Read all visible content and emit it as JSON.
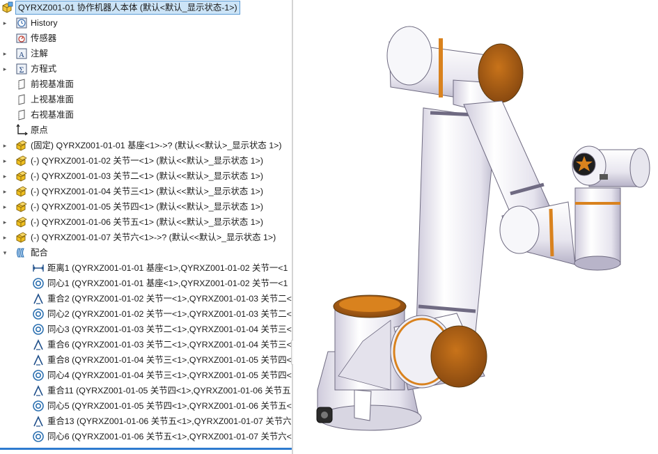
{
  "tree": {
    "root": {
      "label": "QYRXZ001-01 协作机器人本体  (默认<默认_显示状态-1>)",
      "icon": "assembly-icon"
    },
    "items": [
      {
        "label": "History",
        "icon": "history-icon",
        "expander": true
      },
      {
        "label": "传感器",
        "icon": "sensor-icon",
        "expander": false
      },
      {
        "label": "注解",
        "icon": "annotation-icon",
        "expander": true
      },
      {
        "label": "方程式",
        "icon": "equation-icon",
        "expander": true
      },
      {
        "label": "前视基准面",
        "icon": "plane-icon",
        "expander": false
      },
      {
        "label": "上视基准面",
        "icon": "plane-icon",
        "expander": false
      },
      {
        "label": "右视基准面",
        "icon": "plane-icon",
        "expander": false
      },
      {
        "label": "原点",
        "icon": "origin-icon",
        "expander": false
      },
      {
        "label": "(固定) QYRXZ001-01-01 基座<1>->? (默认<<默认>_显示状态 1>)",
        "icon": "part-icon",
        "expander": true
      },
      {
        "label": "(-) QYRXZ001-01-02 关节一<1> (默认<<默认>_显示状态 1>)",
        "icon": "part-icon",
        "expander": true
      },
      {
        "label": "(-) QYRXZ001-01-03 关节二<1> (默认<<默认>_显示状态 1>)",
        "icon": "part-icon",
        "expander": true
      },
      {
        "label": "(-) QYRXZ001-01-04 关节三<1> (默认<<默认>_显示状态 1>)",
        "icon": "part-icon",
        "expander": true
      },
      {
        "label": "(-) QYRXZ001-01-05 关节四<1> (默认<<默认>_显示状态 1>)",
        "icon": "part-icon",
        "expander": true
      },
      {
        "label": "(-) QYRXZ001-01-06 关节五<1> (默认<<默认>_显示状态 1>)",
        "icon": "part-icon",
        "expander": true
      },
      {
        "label": "(-) QYRXZ001-01-07 关节六<1>->? (默认<<默认>_显示状态 1>)",
        "icon": "part-icon",
        "expander": true
      },
      {
        "label": "配合",
        "icon": "mates-icon",
        "expander": true,
        "expanded": true
      }
    ],
    "mates": [
      {
        "label": "距离1 (QYRXZ001-01-01 基座<1>,QYRXZ001-01-02 关节一<1",
        "icon": "distance-mate-icon"
      },
      {
        "label": "同心1 (QYRXZ001-01-01 基座<1>,QYRXZ001-01-02 关节一<1",
        "icon": "concentric-mate-icon"
      },
      {
        "label": "重合2 (QYRXZ001-01-02 关节一<1>,QYRXZ001-01-03 关节二<",
        "icon": "coincident-mate-icon"
      },
      {
        "label": "同心2 (QYRXZ001-01-02 关节一<1>,QYRXZ001-01-03 关节二<",
        "icon": "concentric-mate-icon"
      },
      {
        "label": "同心3 (QYRXZ001-01-03 关节二<1>,QYRXZ001-01-04 关节三<",
        "icon": "concentric-mate-icon"
      },
      {
        "label": "重合6 (QYRXZ001-01-03 关节二<1>,QYRXZ001-01-04 关节三<",
        "icon": "coincident-mate-icon"
      },
      {
        "label": "重合8 (QYRXZ001-01-04 关节三<1>,QYRXZ001-01-05 关节四<",
        "icon": "coincident-mate-icon"
      },
      {
        "label": "同心4 (QYRXZ001-01-04 关节三<1>,QYRXZ001-01-05 关节四<",
        "icon": "concentric-mate-icon"
      },
      {
        "label": "重合11 (QYRXZ001-01-05 关节四<1>,QYRXZ001-01-06 关节五",
        "icon": "coincident-mate-icon"
      },
      {
        "label": "同心5 (QYRXZ001-01-05 关节四<1>,QYRXZ001-01-06 关节五<",
        "icon": "concentric-mate-icon"
      },
      {
        "label": "重合13 (QYRXZ001-01-06 关节五<1>,QYRXZ001-01-07 关节六",
        "icon": "coincident-mate-icon"
      },
      {
        "label": "同心6 (QYRXZ001-01-06 关节五<1>,QYRXZ001-01-07 关节六<",
        "icon": "concentric-mate-icon"
      }
    ]
  },
  "colors": {
    "selection_bg": "#cce4f7",
    "selection_border": "#5b9bd5",
    "part_yellow": "#f0c020",
    "mate_blue": "#2a6fb0",
    "robot_orange": "#d9821e",
    "robot_white": "#f2f2f4",
    "robot_shadow": "#b9b6c8"
  }
}
